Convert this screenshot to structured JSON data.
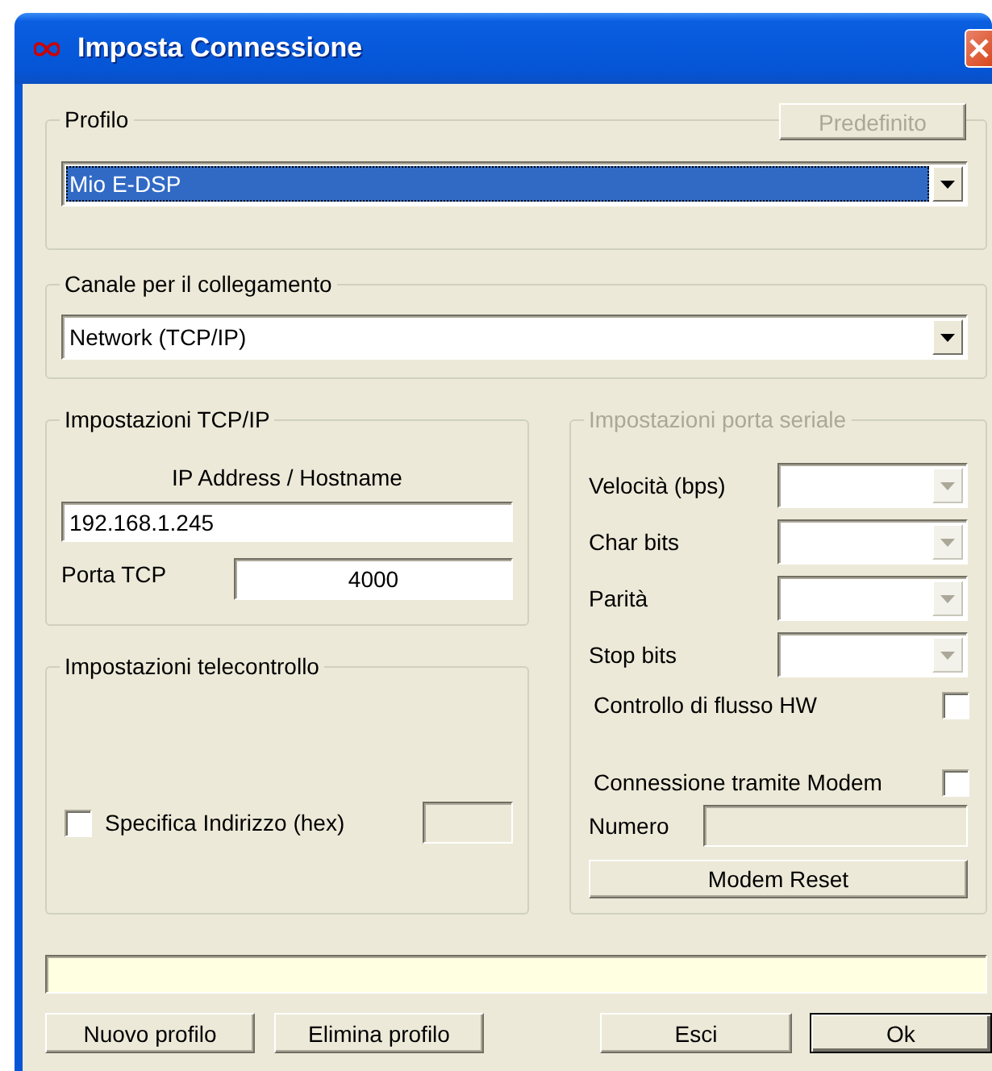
{
  "window": {
    "title": "Imposta Connessione"
  },
  "profile": {
    "label": "Profilo",
    "default_button": {
      "label": "Predefinito",
      "disabled": true
    },
    "dropdown": {
      "value": "Mio E-DSP",
      "highlighted": true
    }
  },
  "channel": {
    "label": "Canale per il collegamento",
    "dropdown": {
      "value": "Network (TCP/IP)",
      "highlighted": false
    }
  },
  "tcp": {
    "label": "Impostazioni TCP/IP",
    "host_label": "IP Address / Hostname",
    "host_value": "192.168.1.245",
    "port_label": "Porta TCP",
    "port_value": "4000"
  },
  "remote": {
    "label": "Impostazioni telecontrollo",
    "address_checkbox": {
      "label": "Specifica Indirizzo (hex)",
      "checked": false
    },
    "address_field": {
      "disabled": true
    }
  },
  "serial": {
    "label": "Impostazioni porta seriale",
    "disabled": true,
    "dropdowns": [
      {
        "label": "Velocità (bps)",
        "disabled": true
      },
      {
        "label": "Char bits",
        "disabled": true
      },
      {
        "label": "Parità",
        "disabled": true
      },
      {
        "label": "Stop bits",
        "disabled": true
      }
    ],
    "flow_control": {
      "label": "Controllo di flusso HW",
      "checked": false
    },
    "modem": {
      "label": "Connessione tramite Modem",
      "checked": false
    },
    "number": {
      "label": "Numero",
      "disabled": true
    },
    "modem_reset": {
      "label": "Modem Reset"
    }
  },
  "buttons": [
    {
      "label": "Nuovo profilo",
      "default": false
    },
    {
      "label": "Elimina profilo",
      "default": false
    },
    {
      "label": "Esci",
      "default": false
    },
    {
      "label": "Ok",
      "default": true
    }
  ]
}
